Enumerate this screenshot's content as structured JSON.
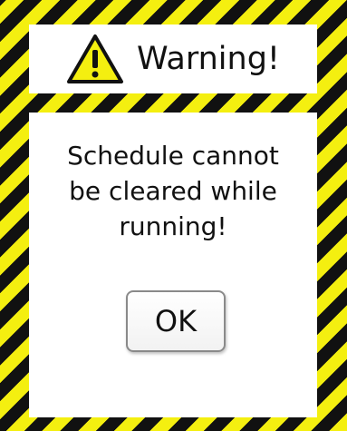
{
  "dialog": {
    "title": "Warning!",
    "icon": "warning-triangle-icon",
    "message_lines": [
      "Schedule cannot",
      "be cleared while",
      "running!"
    ],
    "ok_label": "OK"
  },
  "colors": {
    "stripe_yellow": "#f4ef10",
    "stripe_black": "#111111",
    "panel_bg": "#ffffff"
  }
}
